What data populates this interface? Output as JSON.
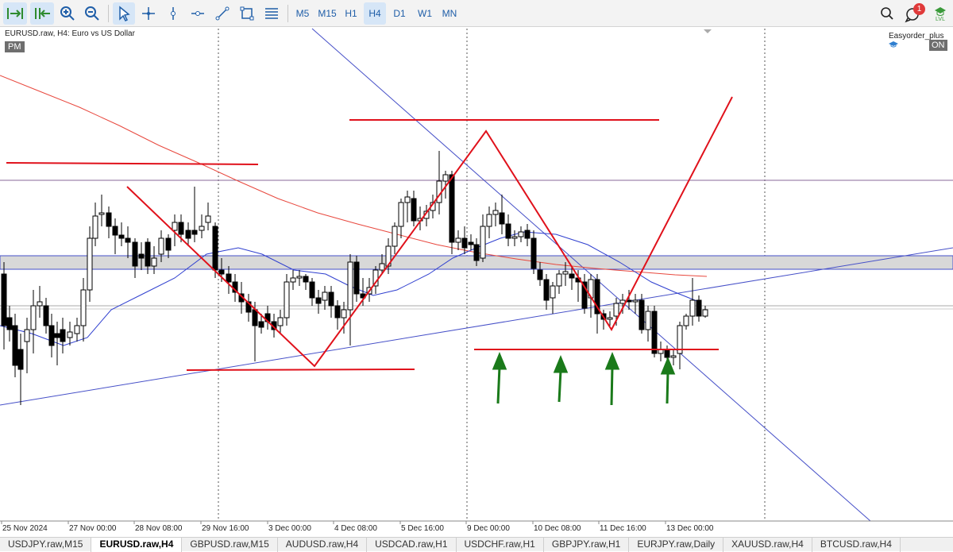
{
  "toolbar": {
    "tools": [
      {
        "name": "auto-scroll",
        "icon": "auto-scroll-icon"
      },
      {
        "name": "chart-shift",
        "icon": "chart-shift-icon"
      },
      {
        "name": "zoom-in",
        "icon": "zoom-in-icon"
      },
      {
        "name": "zoom-out",
        "icon": "zoom-out-icon"
      },
      {
        "name": "cursor",
        "icon": "cursor-icon"
      },
      {
        "name": "crosshair",
        "icon": "crosshair-icon"
      },
      {
        "name": "vertical-line",
        "icon": "vertical-line-icon"
      },
      {
        "name": "horizontal-line",
        "icon": "horizontal-line-icon"
      },
      {
        "name": "trendline",
        "icon": "trendline-icon"
      },
      {
        "name": "rectangle",
        "icon": "rectangle-icon"
      },
      {
        "name": "fibonacci",
        "icon": "fibonacci-icon"
      }
    ],
    "timeframes": [
      "M5",
      "M15",
      "H1",
      "H4",
      "D1",
      "W1",
      "MN"
    ],
    "active_timeframe": "H4",
    "notification_count": "1",
    "lvl_label": "LVL"
  },
  "chart": {
    "title": "EURUSD.raw, H4:  Euro vs US Dollar",
    "pm_badge": "PM",
    "ea_name": "Easyorder_plus",
    "ea_status": "ON",
    "x_labels": [
      "25 Nov 2024",
      "27 Nov 00:00",
      "28 Nov 08:00",
      "29 Nov 16:00",
      "3 Dec 00:00",
      "4 Dec 08:00",
      "5 Dec 16:00",
      "9 Dec 00:00",
      "10 Dec 08:00",
      "11 Dec 16:00",
      "13 Dec 00:00"
    ],
    "colors": {
      "annotation_red": "#e0111b",
      "trendline_blue": "#4650c8",
      "moving_average_blue": "#2f3fcf",
      "moving_average_red": "#e8483e",
      "zone_fill": "#d8d8d8",
      "arrow_green": "#1a7a1a",
      "candle_bull": "#ffffff",
      "candle_bear": "#000000"
    }
  },
  "chart_data": {
    "type": "candlestick",
    "symbol": "EURUSD.raw",
    "timeframe": "H4",
    "annotations": [
      "support line",
      "resistance line",
      "zigzag pattern",
      "4 green arrows at support"
    ]
  },
  "tabs": [
    {
      "label": "USDJPY.raw,M15",
      "active": false
    },
    {
      "label": "EURUSD.raw,H4",
      "active": true
    },
    {
      "label": "GBPUSD.raw,M15",
      "active": false
    },
    {
      "label": "AUDUSD.raw,H4",
      "active": false
    },
    {
      "label": "USDCAD.raw,H1",
      "active": false
    },
    {
      "label": "USDCHF.raw,H1",
      "active": false
    },
    {
      "label": "GBPJPY.raw,H1",
      "active": false
    },
    {
      "label": "EURJPY.raw,Daily",
      "active": false
    },
    {
      "label": "XAUUSD.raw,H4",
      "active": false
    },
    {
      "label": "BTCUSD.raw,H4",
      "active": false
    }
  ]
}
